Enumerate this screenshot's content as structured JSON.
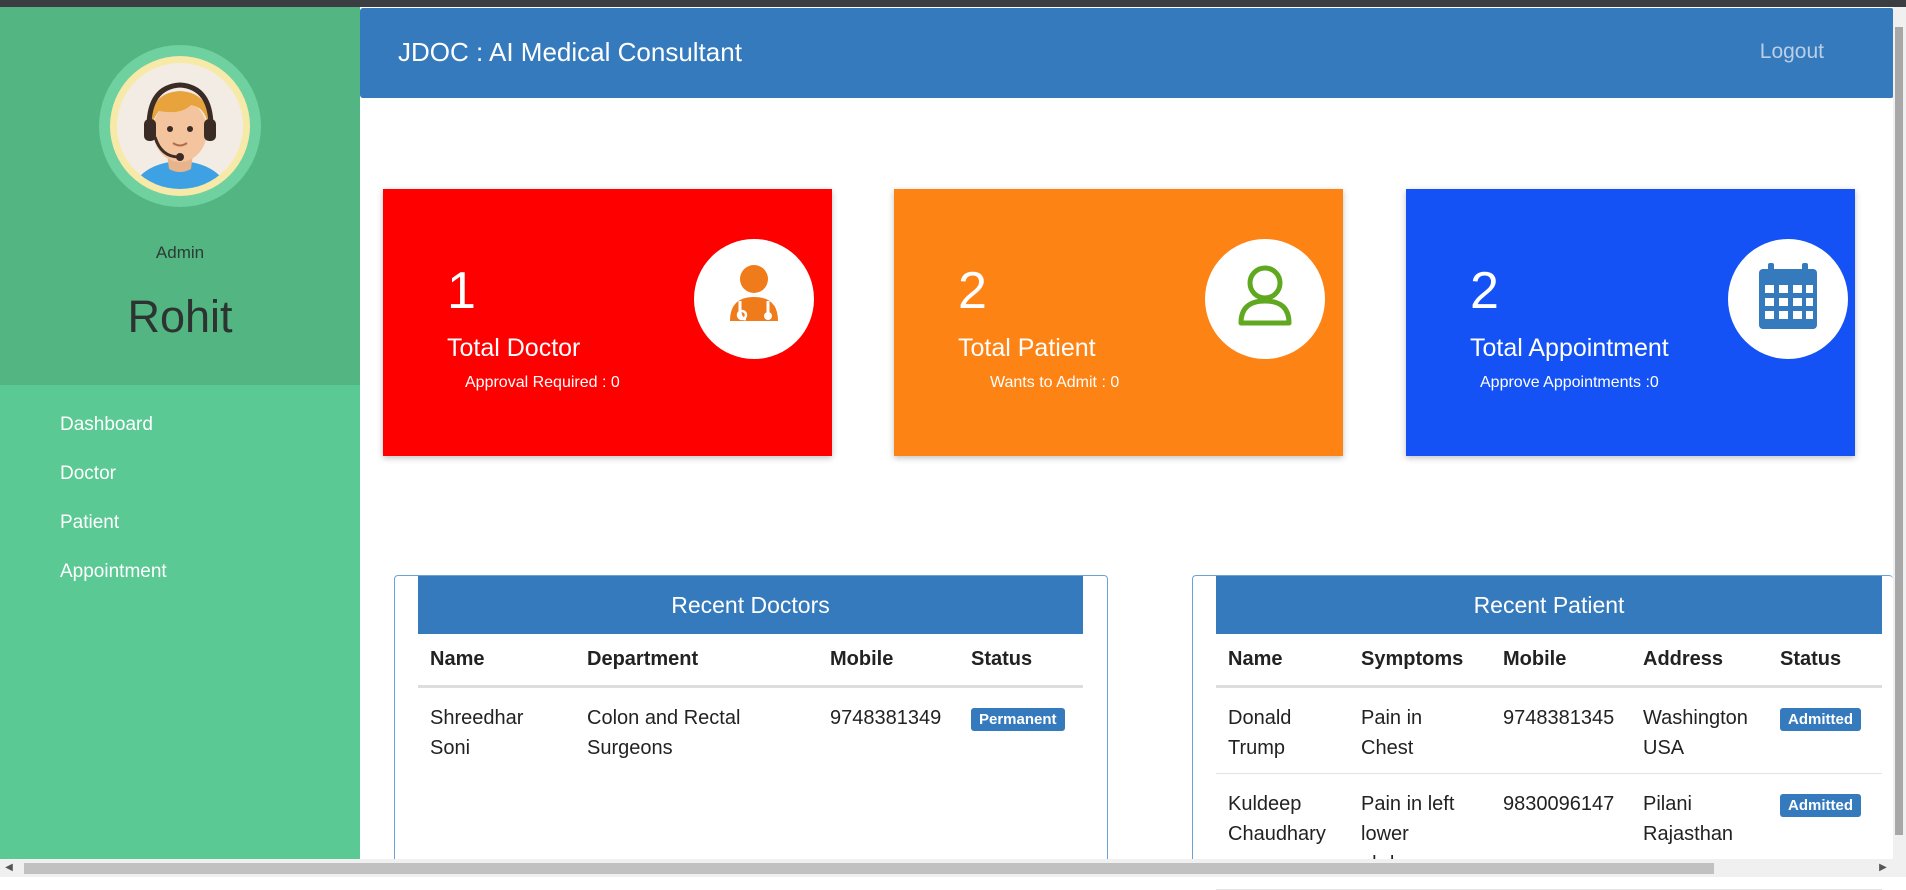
{
  "app": {
    "title": "JDOC : AI Medical Consultant",
    "logout_label": "Logout"
  },
  "profile": {
    "role": "Admin",
    "name": "Rohit",
    "avatar_icon": "support-agent-avatar-icon"
  },
  "sidebar": {
    "items": [
      {
        "label": "Dashboard"
      },
      {
        "label": "Doctor"
      },
      {
        "label": "Patient"
      },
      {
        "label": "Appointment"
      }
    ]
  },
  "cards": [
    {
      "count": "1",
      "label": "Total Doctor",
      "sub": "Approval Required : 0",
      "color": "#ff0000",
      "icon": "doctor-icon",
      "icon_color": "#f07b1a"
    },
    {
      "count": "2",
      "label": "Total Patient",
      "sub": "Wants to Admit : 0",
      "color": "#fd8315",
      "icon": "user-icon",
      "icon_color": "#5fa81f"
    },
    {
      "count": "2",
      "label": "Total Appointment",
      "sub": "Approve Appointments :0",
      "color": "#1452f5",
      "icon": "calendar-icon",
      "icon_color": "#357abd"
    }
  ],
  "recent_doctors": {
    "title": "Recent Doctors",
    "columns": [
      "Name",
      "Department",
      "Mobile",
      "Status"
    ],
    "rows": [
      {
        "name": "Shreedhar Soni",
        "department": "Colon and Rectal Surgeons",
        "mobile": "9748381349",
        "status": "Permanent"
      }
    ]
  },
  "recent_patients": {
    "title": "Recent Patient",
    "columns": [
      "Name",
      "Symptoms",
      "Mobile",
      "Address",
      "Status"
    ],
    "rows": [
      {
        "name": "Donald Trump",
        "symptoms": "Pain in Chest",
        "mobile": "9748381345",
        "address": "Washington USA",
        "status": "Admitted"
      },
      {
        "name": "Kuldeep Chaudhary",
        "symptoms": "Pain in left lower abdomen",
        "mobile": "9830096147",
        "address": "Pilani Rajasthan",
        "status": "Admitted"
      }
    ]
  }
}
